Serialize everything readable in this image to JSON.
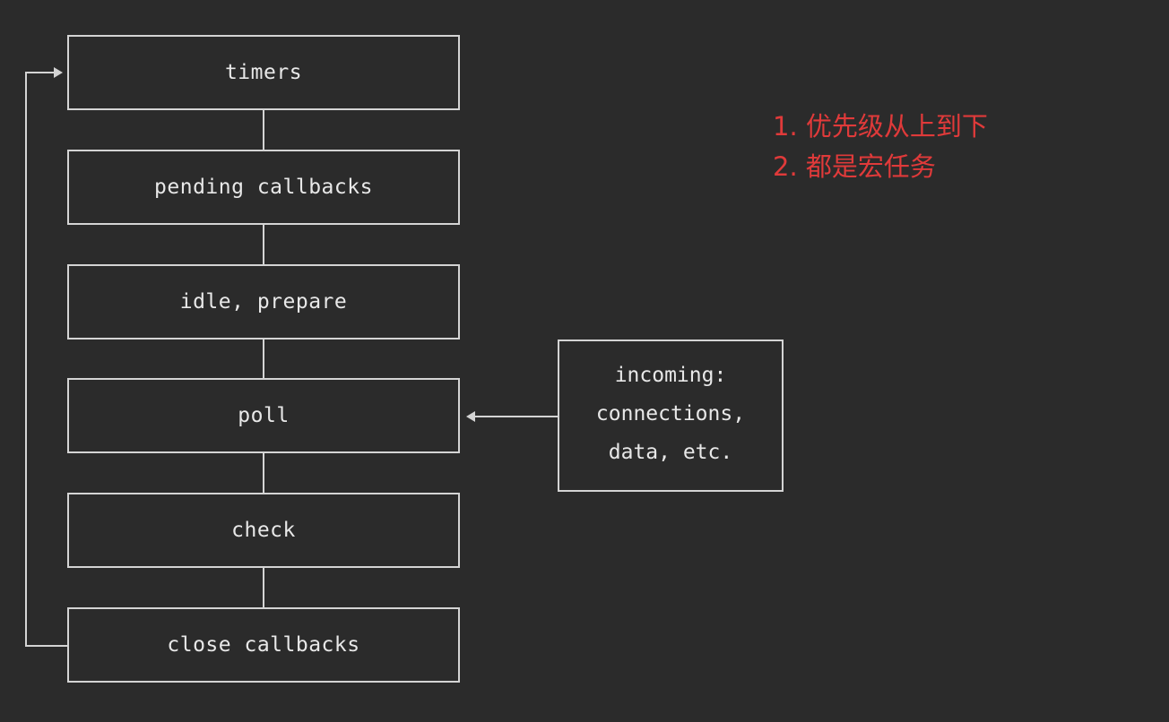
{
  "phases": [
    {
      "label": "timers"
    },
    {
      "label": "pending callbacks"
    },
    {
      "label": "idle, prepare"
    },
    {
      "label": "poll"
    },
    {
      "label": "check"
    },
    {
      "label": "close callbacks"
    }
  ],
  "incoming": {
    "lines": [
      "incoming:",
      "connections,",
      "data, etc."
    ]
  },
  "notes": [
    "1. 优先级从上到下",
    "2. 都是宏任务"
  ],
  "colors": {
    "background": "#2b2b2b",
    "text": "#e8e8e8",
    "lines": "#d4d4d4",
    "note": "#e03a3a"
  }
}
